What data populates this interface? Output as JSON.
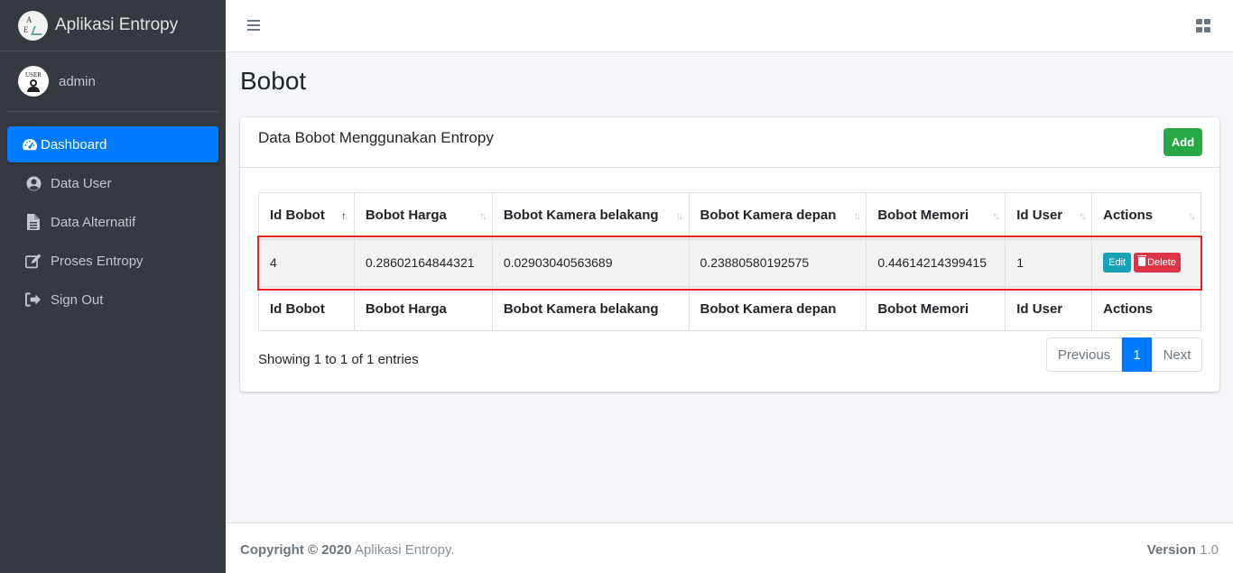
{
  "brand": {
    "title": "Aplikasi Entropy",
    "logo_letters": [
      "A",
      "E"
    ]
  },
  "user": {
    "name": "admin",
    "avatar_text": "USER"
  },
  "nav": [
    {
      "label": "Dashboard",
      "icon": "tachometer-icon",
      "active": true
    },
    {
      "label": "Data User",
      "icon": "user-circle-icon"
    },
    {
      "label": "Data Alternatif",
      "icon": "file-icon"
    },
    {
      "label": "Proses Entropy",
      "icon": "edit-icon"
    },
    {
      "label": "Sign Out",
      "icon": "sign-out-icon"
    }
  ],
  "page": {
    "title": "Bobot"
  },
  "card": {
    "title": "Data Bobot Menggunakan Entropy",
    "add_label": "Add"
  },
  "table": {
    "columns": [
      "Id Bobot",
      "Bobot Harga",
      "Bobot Kamera belakang",
      "Bobot Kamera depan",
      "Bobot Memori",
      "Id User",
      "Actions"
    ],
    "rows": [
      [
        "4",
        "0.28602164844321",
        "0.02903040563689",
        "0.23880580192575",
        "0.44614214399415",
        "1"
      ]
    ],
    "edit_label": "Edit",
    "delete_label": "Delete"
  },
  "pagination": {
    "info": "Showing 1 to 1 of 1 entries",
    "previous": "Previous",
    "current": "1",
    "next": "Next"
  },
  "footer": {
    "copyright_bold": "Copyright © 2020",
    "copyright_text": " Aplikasi Entropy.",
    "version_label": "Version",
    "version_value": " 1.0"
  },
  "colors": {
    "sidebar": "#343a40",
    "accent": "#007bff",
    "add": "#28a745",
    "edit": "#17a2b8",
    "delete": "#dc3545",
    "highlight": "#e8202a"
  }
}
